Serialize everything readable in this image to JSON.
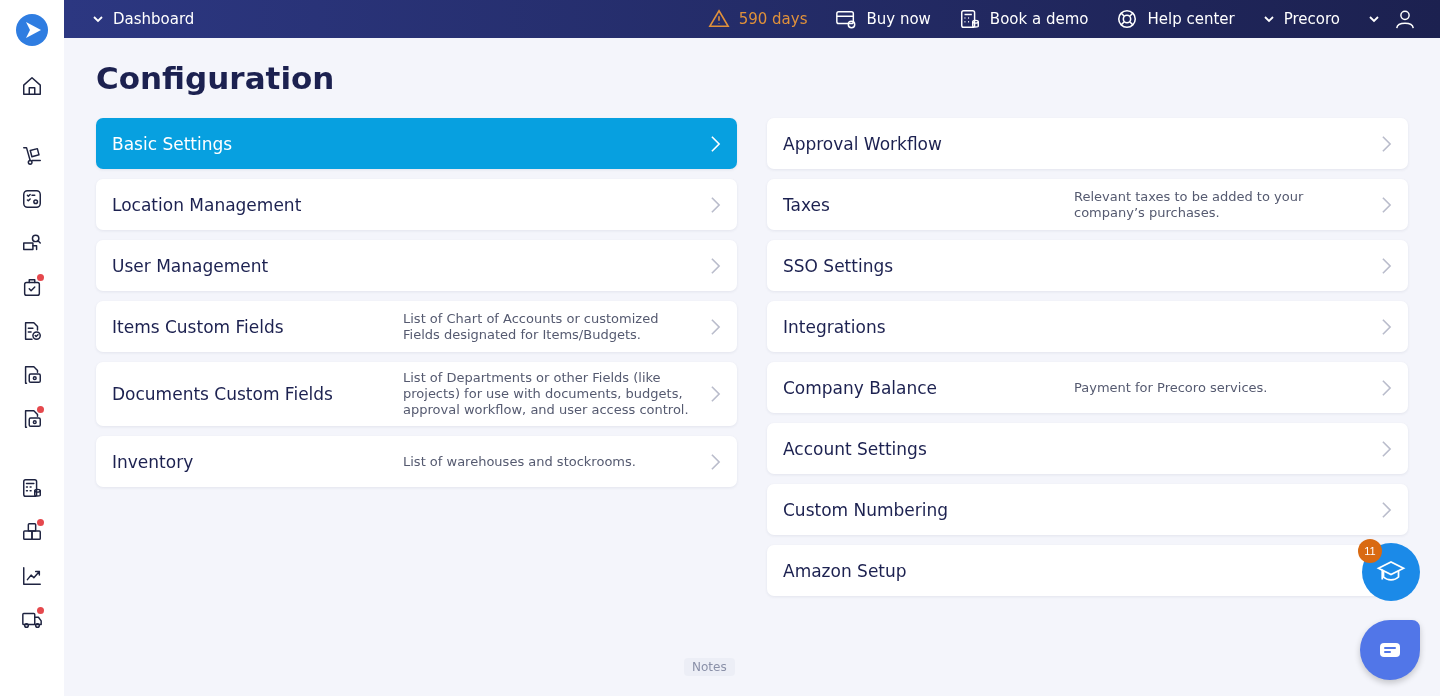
{
  "sidebar": {
    "items": [
      {
        "kind": "home",
        "badge": false
      },
      {
        "kind": "cart",
        "badge": false
      },
      {
        "kind": "checklist",
        "badge": false
      },
      {
        "kind": "search-truck",
        "badge": false
      },
      {
        "kind": "bag",
        "badge": true
      },
      {
        "kind": "doc-check",
        "badge": false
      },
      {
        "kind": "doc-money",
        "badge": false
      },
      {
        "kind": "doc-money",
        "badge": true
      },
      {
        "kind": "calculator",
        "badge": false
      },
      {
        "kind": "boxes",
        "badge": true
      },
      {
        "kind": "chart",
        "badge": false
      },
      {
        "kind": "truck",
        "badge": true
      }
    ]
  },
  "topbar": {
    "menu": "Dashboard",
    "trial": "590 days",
    "buy": "Buy now",
    "demo": "Book a demo",
    "help": "Help center",
    "company": "Precoro"
  },
  "title": "Configuration",
  "left": [
    {
      "label": "Basic Settings",
      "selected": true
    },
    {
      "label": "Location Management",
      "selected": false
    },
    {
      "label": "User Management",
      "selected": false
    },
    {
      "label": "Items Custom Fields",
      "description": "List of Chart of Accounts or customized Fields designated for Items/Budgets.",
      "selected": false
    },
    {
      "label": "Documents Custom Fields",
      "description": "List of Departments or other Fields (like projects) for use with documents, budgets, approval workflow, and user access control.",
      "selected": false
    },
    {
      "label": "Inventory",
      "description": "List of warehouses and stockrooms.",
      "selected": false
    }
  ],
  "right": [
    {
      "label": "Approval Workflow",
      "selected": false
    },
    {
      "label": "Taxes",
      "description": "Relevant taxes to be added to your company’s purchases.",
      "selected": false
    },
    {
      "label": "SSO Settings",
      "selected": false
    },
    {
      "label": "Integrations",
      "selected": false
    },
    {
      "label": "Company Balance",
      "description": "Payment for Precoro services.",
      "selected": false
    },
    {
      "label": "Account Settings",
      "selected": false
    },
    {
      "label": "Custom Numbering",
      "selected": false
    },
    {
      "label": "Amazon Setup",
      "selected": false
    }
  ],
  "learning_badge": "11",
  "notes_tab": "Notes"
}
